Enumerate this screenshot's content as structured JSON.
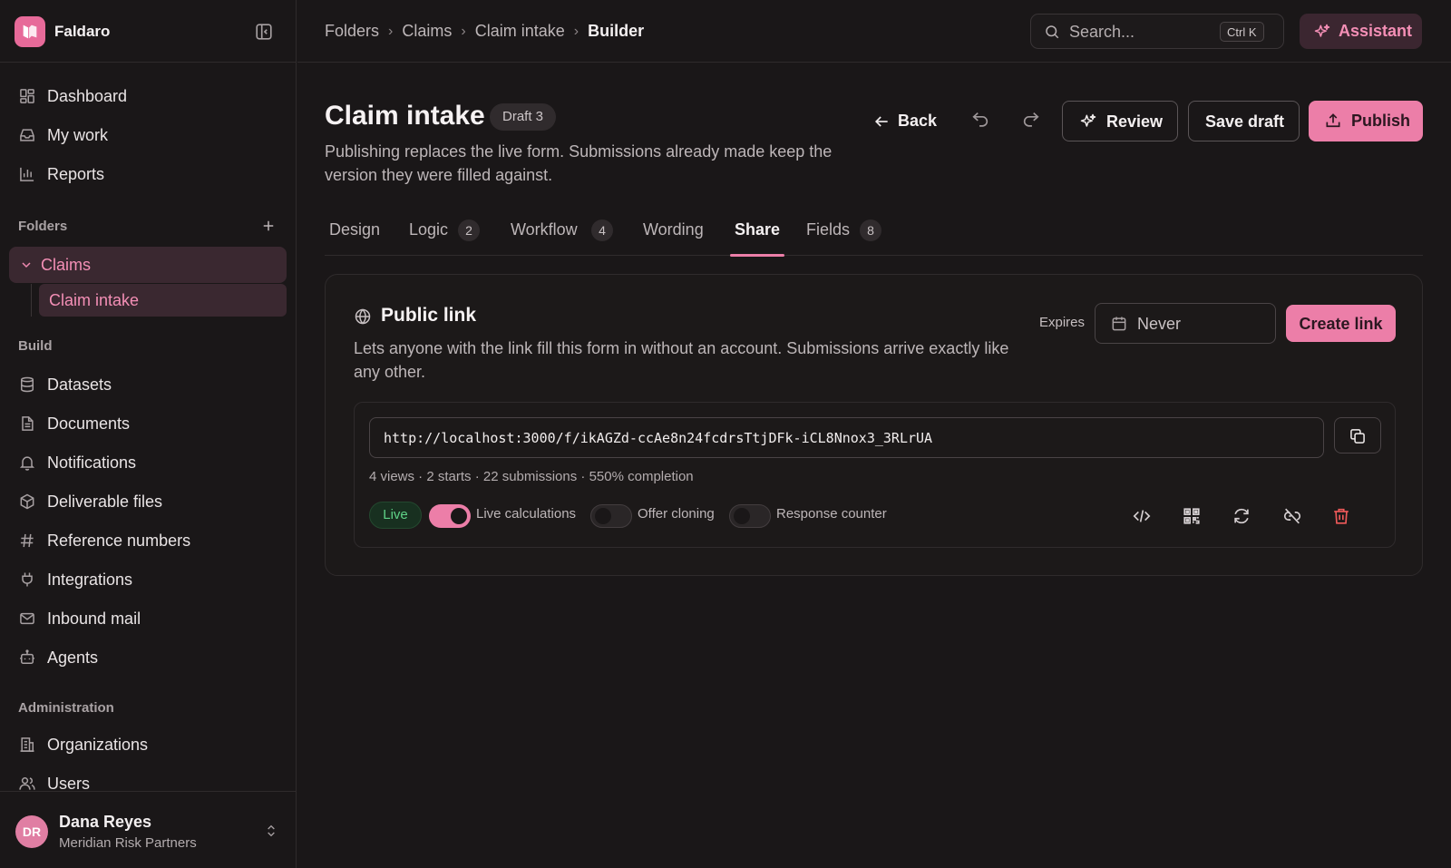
{
  "app": {
    "name": "Faldaro"
  },
  "sidebar": {
    "nav": [
      {
        "label": "Dashboard",
        "icon": "dashboard-icon"
      },
      {
        "label": "My work",
        "icon": "inbox-icon"
      },
      {
        "label": "Reports",
        "icon": "bar-chart-icon"
      }
    ],
    "folders_label": "Folders",
    "folders": {
      "parent": "Claims",
      "child": "Claim intake"
    },
    "build_label": "Build",
    "build": [
      {
        "label": "Datasets",
        "icon": "database-icon"
      },
      {
        "label": "Documents",
        "icon": "document-icon"
      },
      {
        "label": "Notifications",
        "icon": "bell-icon"
      },
      {
        "label": "Deliverable files",
        "icon": "package-icon"
      },
      {
        "label": "Reference numbers",
        "icon": "hash-icon"
      },
      {
        "label": "Integrations",
        "icon": "plug-icon"
      },
      {
        "label": "Inbound mail",
        "icon": "mail-icon"
      },
      {
        "label": "Agents",
        "icon": "bot-icon"
      }
    ],
    "admin_label": "Administration",
    "admin": [
      {
        "label": "Organizations",
        "icon": "building-icon"
      },
      {
        "label": "Users",
        "icon": "users-icon"
      }
    ],
    "user": {
      "initials": "DR",
      "name": "Dana Reyes",
      "org": "Meridian Risk Partners"
    }
  },
  "topbar": {
    "breadcrumb": [
      "Folders",
      "Claims",
      "Claim intake",
      "Builder"
    ],
    "search": {
      "placeholder": "Search...",
      "shortcut": "Ctrl K"
    },
    "assistant_label": "Assistant"
  },
  "header": {
    "title": "Claim intake",
    "badge": "Draft 3",
    "description": "Publishing replaces the live form. Submissions already made keep the version they were filled against.",
    "back_label": "Back",
    "review_label": "Review",
    "save_draft_label": "Save draft",
    "publish_label": "Publish"
  },
  "tabs": [
    {
      "label": "Design",
      "count": null
    },
    {
      "label": "Logic",
      "count": "2"
    },
    {
      "label": "Workflow",
      "count": "4"
    },
    {
      "label": "Wording",
      "count": null
    },
    {
      "label": "Share",
      "count": null,
      "active": true
    },
    {
      "label": "Fields",
      "count": "8"
    }
  ],
  "share": {
    "title": "Public link",
    "description": "Lets anyone with the link fill this form in without an account. Submissions arrive exactly like any other.",
    "expires_label": "Expires",
    "expires_value": "Never",
    "create_link_label": "Create link",
    "link": {
      "url": "http://localhost:3000/f/ikAGZd-ccAe8n24fcdrsTtjDFk-iCL8Nnox3_3RLrUA",
      "stats": "4 views · 2 starts · 22 submissions · 550% completion",
      "status": "Live",
      "toggles": [
        {
          "label": "Live calculations",
          "on": true
        },
        {
          "label": "Offer cloning",
          "on": false
        },
        {
          "label": "Response counter",
          "on": false
        }
      ],
      "actions": [
        "embed-code-icon",
        "qr-code-icon",
        "regenerate-icon",
        "unlink-icon",
        "trash-icon"
      ]
    }
  },
  "colors": {
    "accent": "#ec7ea8",
    "live": "#5fd287",
    "danger": "#f05a5a",
    "background": "#1a1718"
  }
}
